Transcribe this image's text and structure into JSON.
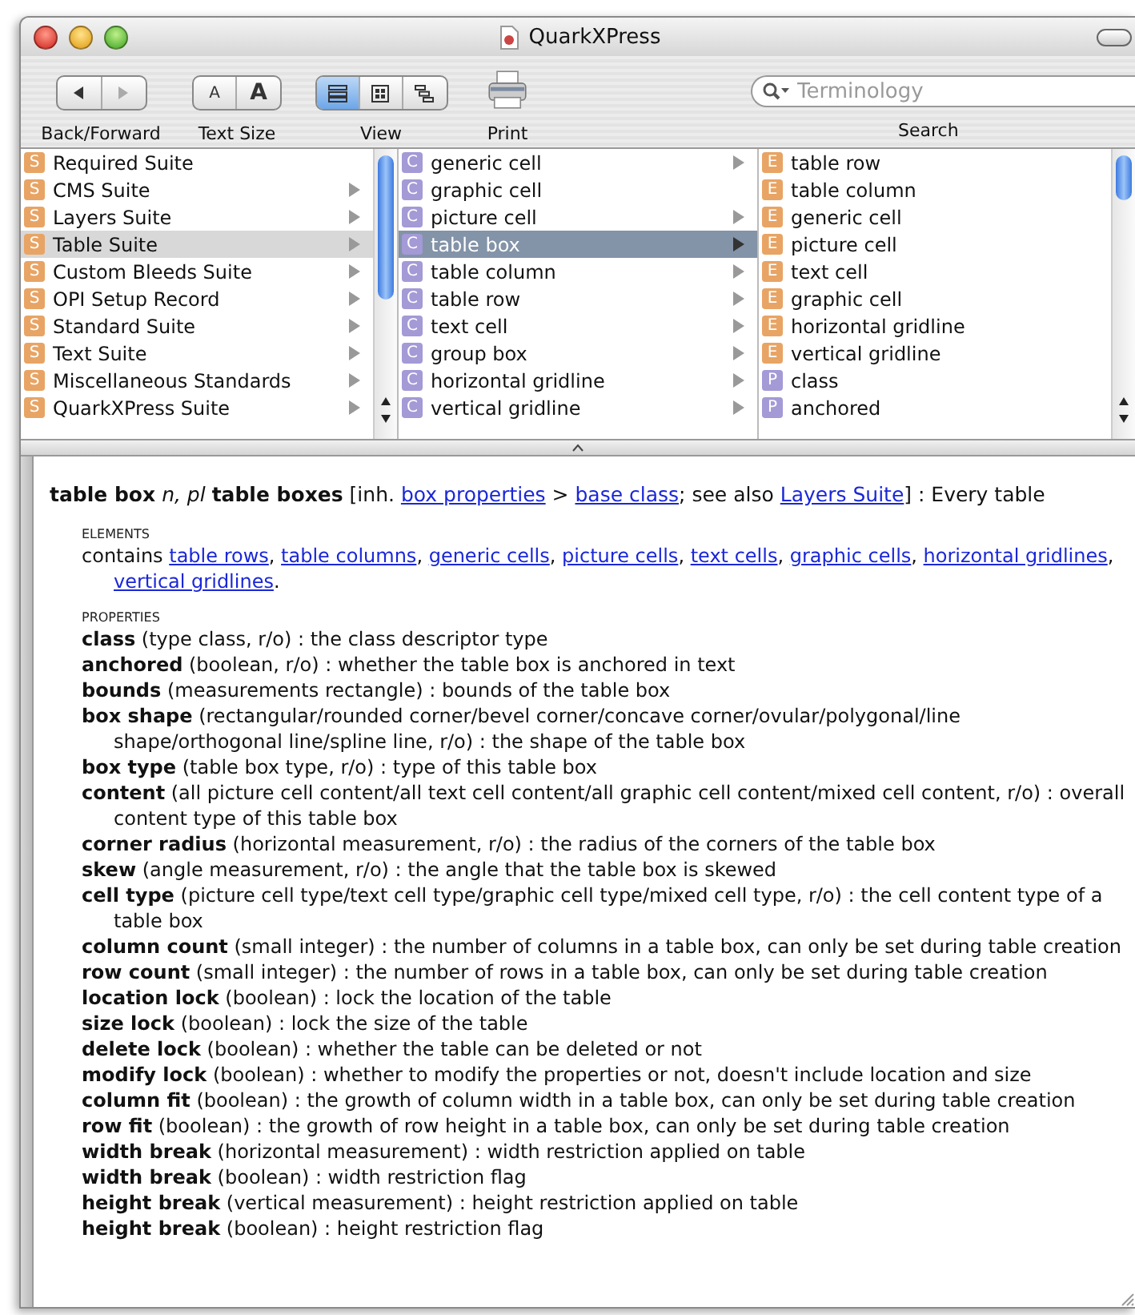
{
  "window": {
    "title": "QuarkXPress"
  },
  "toolbar": [
    {
      "kind": "nav",
      "label": "Back/Forward"
    },
    {
      "kind": "textsize",
      "label": "Text Size",
      "segments": [
        {
          "text": "A",
          "kind": "small"
        },
        {
          "text": "A",
          "kind": "large"
        }
      ]
    },
    {
      "kind": "view",
      "label": "View",
      "segments": [
        {
          "kind": "list",
          "selected": true
        },
        {
          "kind": "grid",
          "selected": false
        },
        {
          "kind": "tree",
          "selected": false
        }
      ]
    },
    {
      "kind": "print",
      "label": "Print"
    },
    {
      "kind": "search",
      "label": "Search",
      "placeholder": "Terminology"
    }
  ],
  "columns": [
    {
      "focused": false,
      "items": [
        {
          "badge": "S",
          "color": "#e8a464",
          "label": "Required Suite",
          "expandable": false,
          "selected": false
        },
        {
          "badge": "S",
          "color": "#e8a464",
          "label": "CMS Suite",
          "expandable": true,
          "selected": false
        },
        {
          "badge": "S",
          "color": "#e8a464",
          "label": "Layers Suite",
          "expandable": true,
          "selected": false
        },
        {
          "badge": "S",
          "color": "#e8a464",
          "label": "Table Suite",
          "expandable": true,
          "selected": true
        },
        {
          "badge": "S",
          "color": "#e8a464",
          "label": "Custom Bleeds Suite",
          "expandable": true,
          "selected": false
        },
        {
          "badge": "S",
          "color": "#e8a464",
          "label": "OPI Setup Record",
          "expandable": true,
          "selected": false
        },
        {
          "badge": "S",
          "color": "#e8a464",
          "label": "Standard Suite",
          "expandable": true,
          "selected": false
        },
        {
          "badge": "S",
          "color": "#e8a464",
          "label": "Text Suite",
          "expandable": true,
          "selected": false
        },
        {
          "badge": "S",
          "color": "#e8a464",
          "label": "Miscellaneous Standards",
          "expandable": true,
          "selected": false
        },
        {
          "badge": "S",
          "color": "#e8a464",
          "label": "QuarkXPress Suite",
          "expandable": true,
          "selected": false
        }
      ]
    },
    {
      "focused": true,
      "items": [
        {
          "badge": "C",
          "color": "#a39ad6",
          "label": "generic cell",
          "expandable": true,
          "selected": false
        },
        {
          "badge": "C",
          "color": "#a39ad6",
          "label": "graphic cell",
          "expandable": false,
          "selected": false
        },
        {
          "badge": "C",
          "color": "#a39ad6",
          "label": "picture cell",
          "expandable": true,
          "selected": false
        },
        {
          "badge": "C",
          "color": "#a39ad6",
          "label": "table box",
          "expandable": true,
          "selected": true
        },
        {
          "badge": "C",
          "color": "#a39ad6",
          "label": "table column",
          "expandable": true,
          "selected": false
        },
        {
          "badge": "C",
          "color": "#a39ad6",
          "label": "table row",
          "expandable": true,
          "selected": false
        },
        {
          "badge": "C",
          "color": "#a39ad6",
          "label": "text cell",
          "expandable": true,
          "selected": false
        },
        {
          "badge": "C",
          "color": "#a39ad6",
          "label": "group box",
          "expandable": true,
          "selected": false
        },
        {
          "badge": "C",
          "color": "#a39ad6",
          "label": "horizontal gridline",
          "expandable": true,
          "selected": false
        },
        {
          "badge": "C",
          "color": "#a39ad6",
          "label": "vertical gridline",
          "expandable": true,
          "selected": false
        }
      ]
    },
    {
      "items": [
        {
          "badge": "E",
          "color": "#e8a464",
          "label": "table row",
          "expandable": false,
          "selected": false
        },
        {
          "badge": "E",
          "color": "#e8a464",
          "label": "table column",
          "expandable": false,
          "selected": false
        },
        {
          "badge": "E",
          "color": "#e8a464",
          "label": "generic cell",
          "expandable": false,
          "selected": false
        },
        {
          "badge": "E",
          "color": "#e8a464",
          "label": "picture cell",
          "expandable": false,
          "selected": false
        },
        {
          "badge": "E",
          "color": "#e8a464",
          "label": "text cell",
          "expandable": false,
          "selected": false
        },
        {
          "badge": "E",
          "color": "#e8a464",
          "label": "graphic cell",
          "expandable": false,
          "selected": false
        },
        {
          "badge": "E",
          "color": "#e8a464",
          "label": "horizontal gridline",
          "expandable": false,
          "selected": false
        },
        {
          "badge": "E",
          "color": "#e8a464",
          "label": "vertical gridline",
          "expandable": false,
          "selected": false
        },
        {
          "badge": "P",
          "color": "#a39ad6",
          "label": "class",
          "expandable": false,
          "selected": false
        },
        {
          "badge": "P",
          "color": "#a39ad6",
          "label": "anchored",
          "expandable": false,
          "selected": false
        }
      ]
    }
  ],
  "definition": {
    "header": [
      {
        "kind": "text",
        "text": "**table box** *n, pl* **table boxes** [inh. "
      },
      {
        "kind": "link",
        "text": "box properties"
      },
      {
        "kind": "text",
        "text": " > "
      },
      {
        "kind": "link",
        "text": "base class"
      },
      {
        "kind": "text",
        "text": "; see also "
      },
      {
        "kind": "link",
        "text": "Layers Suite"
      },
      {
        "kind": "text",
        "text": "] : Every table"
      }
    ],
    "elements_heading": "ELEMENTS",
    "elements": [
      {
        "kind": "text",
        "text": "contains "
      },
      {
        "kind": "link",
        "text": "table rows"
      },
      {
        "kind": "text",
        "text": ", "
      },
      {
        "kind": "link",
        "text": "table columns"
      },
      {
        "kind": "text",
        "text": ", "
      },
      {
        "kind": "link",
        "text": "generic cells"
      },
      {
        "kind": "text",
        "text": ", "
      },
      {
        "kind": "link",
        "text": "picture cells"
      },
      {
        "kind": "text",
        "text": ", "
      },
      {
        "kind": "link",
        "text": "text cells"
      },
      {
        "kind": "text",
        "text": ", "
      },
      {
        "kind": "link",
        "text": "graphic cells"
      },
      {
        "kind": "text",
        "text": ", "
      },
      {
        "kind": "link",
        "text": "horizontal gridlines"
      },
      {
        "kind": "text",
        "text": ", "
      },
      {
        "kind": "link",
        "text": "vertical gridlines"
      },
      {
        "kind": "text",
        "text": "."
      }
    ],
    "properties_heading": "PROPERTIES",
    "properties": [
      "**class** (type class, r/o) : the class descriptor type",
      "**anchored** (boolean, r/o) : whether the table box is anchored in text",
      "**bounds** (measurements rectangle) : bounds of the table box",
      "**box shape** (rectangular/rounded corner/bevel corner/concave corner/ovular/polygonal/line shape/orthogonal line/spline line, r/o) : the shape of the table box",
      "**box type** (table box type, r/o) : type of this table box",
      "**content** (all picture cell content/all text cell content/all graphic cell content/mixed cell content, r/o) : overall content type of this table box",
      "**corner radius** (horizontal measurement, r/o) : the radius of the corners of the table box",
      "**skew** (angle measurement, r/o) : the angle that the table box is skewed",
      "**cell type** (picture cell type/text cell type/graphic cell type/mixed cell type, r/o) : the cell content type of a table box",
      "**column count** (small integer) : the number of columns in a table box, can only be set during table creation",
      "**row count** (small integer) : the number of rows in a table box, can only be set during table creation",
      "**location lock** (boolean) : lock the location of the table",
      "**size lock** (boolean) : lock the size of the table",
      "**delete lock** (boolean) : whether the table can be deleted or not",
      "**modify lock** (boolean) : whether to modify the properties or not, doesn't include location and size",
      "**column fit** (boolean) : the growth of column width in a table box, can only be set during table creation",
      "**row fit** (boolean) : the growth of row height in a table box, can only be set during table creation",
      "**width break** (horizontal measurement) : width restriction applied on table",
      "**width break** (boolean) : width restriction flag",
      "**height break** (vertical measurement) : height restriction applied on table",
      "**height break** (boolean) : height restriction flag"
    ]
  }
}
